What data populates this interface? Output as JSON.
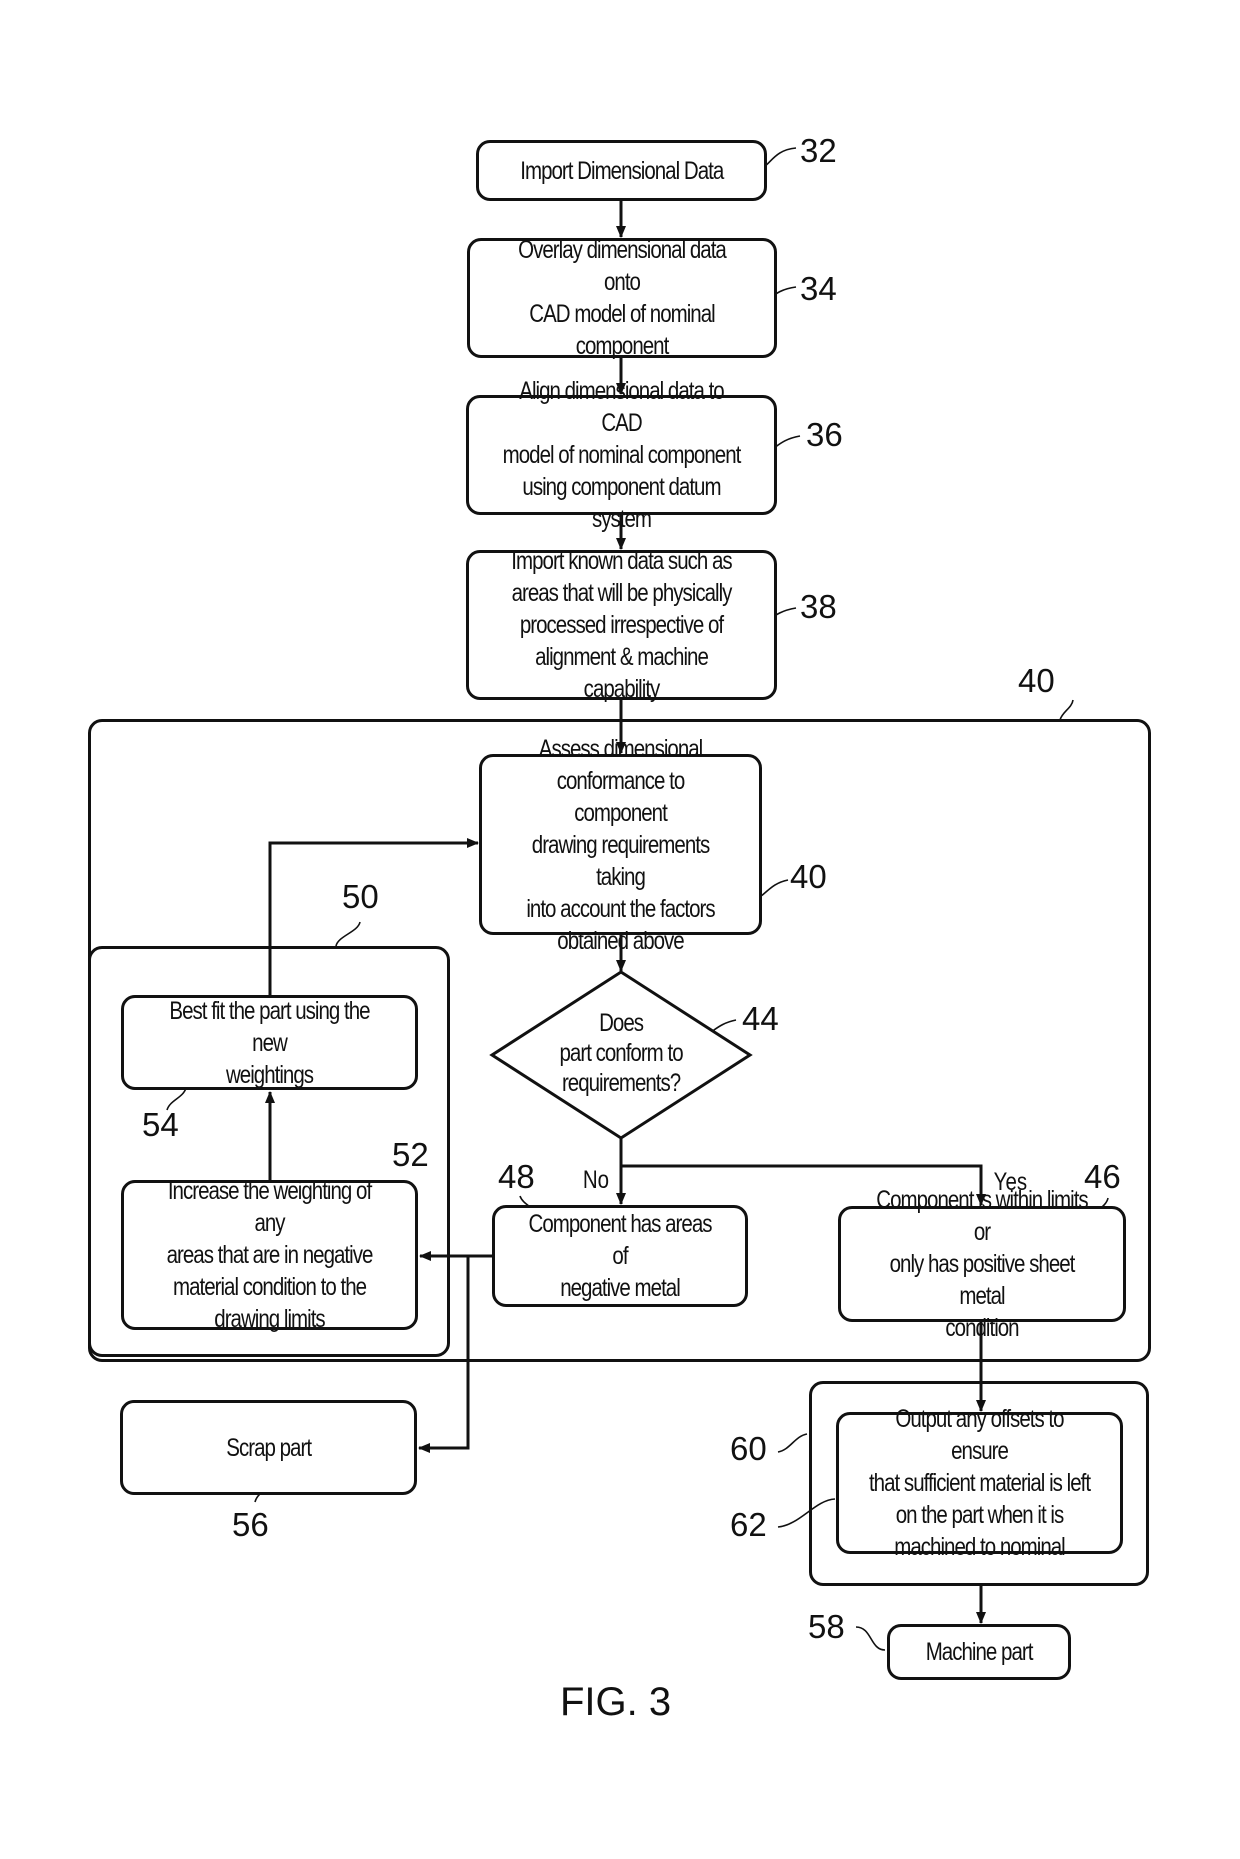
{
  "figure": {
    "caption": "FIG. 3"
  },
  "steps": {
    "s32": {
      "ref": "32",
      "text": "Import Dimensional Data"
    },
    "s34": {
      "ref": "34",
      "text": "Overlay dimensional data onto\nCAD model of nominal\ncomponent"
    },
    "s36": {
      "ref": "36",
      "text": "Align dimensional data to CAD\nmodel of nominal component\nusing component datum system"
    },
    "s38": {
      "ref": "38",
      "text": "Import known data such as\nareas that will be physically\nprocessed irrespective of\nalignment & machine capability"
    },
    "s40": {
      "ref": "40",
      "text": "Assess dimensional\nconformance to component\ndrawing requirements taking\ninto account the factors\nobtained above"
    },
    "s44": {
      "ref": "44",
      "text": "Does\npart conform to\nrequirements?"
    },
    "s46": {
      "ref": "46",
      "text": "Component is within limits or\nonly has positive sheet metal\ncondition"
    },
    "s48": {
      "ref": "48",
      "text": "Component has areas of\nnegative metal"
    },
    "s52": {
      "ref": "52",
      "text": "Increase the weighting of any\nareas that are in negative\nmaterial condition to the\ndrawing limits"
    },
    "s54": {
      "ref": "54",
      "text": "Best fit the part using the new\nweightings"
    },
    "s56": {
      "ref": "56",
      "text": "Scrap part"
    },
    "s58": {
      "ref": "58",
      "text": "Machine part"
    },
    "s62": {
      "ref": "62",
      "text": "Output any offsets to ensure\nthat sufficient material is left\non the part when it is\nmachined to nominal"
    }
  },
  "groups": {
    "g40": {
      "ref": "40"
    },
    "g50": {
      "ref": "50"
    },
    "g60": {
      "ref": "60"
    }
  },
  "branches": {
    "no": "No",
    "yes": "Yes"
  }
}
